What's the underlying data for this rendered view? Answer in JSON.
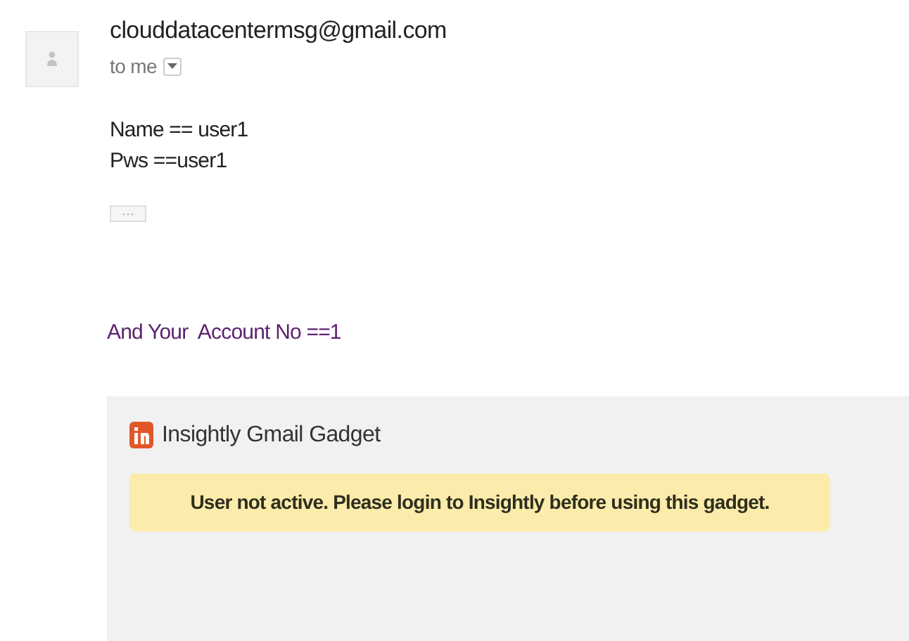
{
  "sender": "clouddatacentermsg@gmail.com",
  "recipient": "to me",
  "body_lines": [
    "Name == user1",
    "Pws ==user1"
  ],
  "trimmed_content_button": "···",
  "account_line": "And Your  Account No ==1",
  "gadget": {
    "title": "Insightly Gmail Gadget",
    "message": "User not active. Please login to Insightly before using this gadget."
  }
}
